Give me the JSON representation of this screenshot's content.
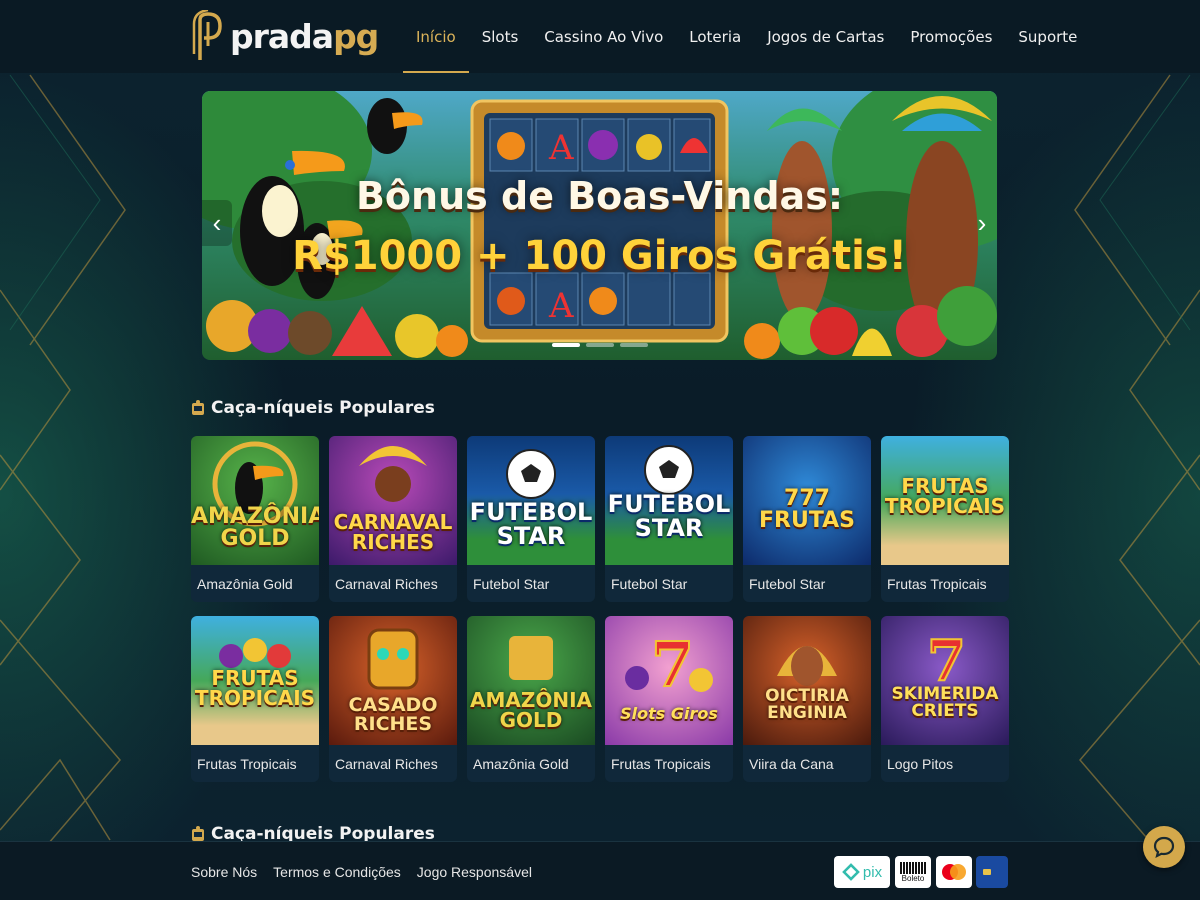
{
  "header": {
    "logo_text_white": "prada",
    "logo_text_gold": "pg",
    "nav": [
      {
        "label": "Início",
        "active": true
      },
      {
        "label": "Slots"
      },
      {
        "label": "Cassino Ao Vivo"
      },
      {
        "label": "Loteria"
      },
      {
        "label": "Jogos de Cartas"
      },
      {
        "label": "Promoções"
      },
      {
        "label": "Suporte"
      }
    ]
  },
  "banner": {
    "title": "Bônus de Boas-Vindas:",
    "subtitle": "R$1000 + 100 Giros Grátis!",
    "prev_icon": "chevron-left-icon",
    "next_icon": "chevron-right-icon",
    "active_slide": 1,
    "slide_count": 3
  },
  "sections": [
    {
      "title": "Caça-níqueis Populares",
      "rows": [
        [
          {
            "thumb_title": "AMAZÔNIA GOLD",
            "name": "Amazônia Gold"
          },
          {
            "thumb_title": "CARNAVAL RICHES",
            "name": "Carnaval Riches"
          },
          {
            "thumb_title": "FUTEBOL STAR",
            "name": "Futebol Star"
          },
          {
            "thumb_title": "FUTEBOL STAR",
            "name": "Futebol Star"
          },
          {
            "thumb_title": "777 FRUTAS",
            "name": "Futebol Star"
          },
          {
            "thumb_title": "FRUTAS TROPICAIS",
            "name": "Frutas Tropicais"
          }
        ],
        [
          {
            "thumb_title": "FRUTAS TROPICAIS",
            "name": "Frutas Tropicais"
          },
          {
            "thumb_title": "CASADO RICHES",
            "name": "Carnaval Riches"
          },
          {
            "thumb_title": "AMAZÔNIA GOLD",
            "name": "Amazônia Gold"
          },
          {
            "thumb_title": "Slots Giros",
            "name": "Frutas Tropicais"
          },
          {
            "thumb_title": "OICTIRIA ENGINIA",
            "name": "Viira da Cana"
          },
          {
            "thumb_title": "SKIMERIDA CRIETS",
            "name": "Logo Pitos"
          }
        ]
      ]
    },
    {
      "title": "Caça-níqueis Populares"
    }
  ],
  "footer": {
    "links": [
      "Sobre Nós",
      "Termos e Condições",
      "Jogo Responsável"
    ],
    "payments": [
      "pix",
      "Boleto"
    ]
  },
  "chat_icon": "chat-bubble-icon"
}
